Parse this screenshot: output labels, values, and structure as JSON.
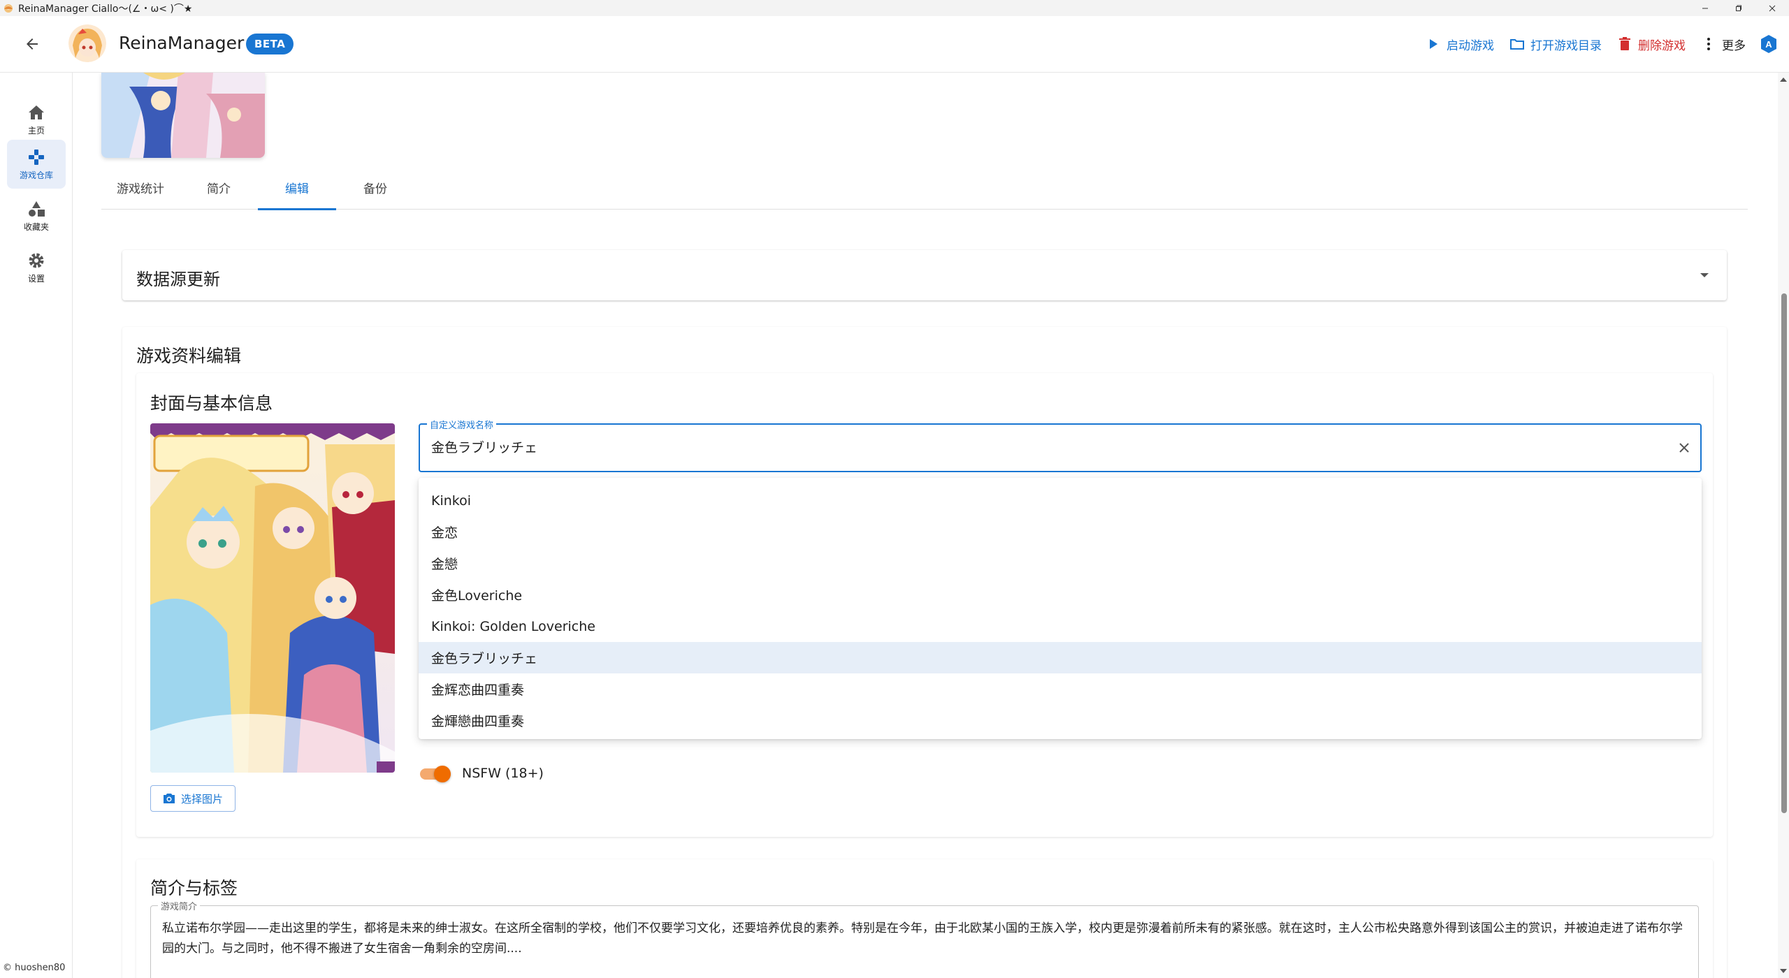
{
  "window": {
    "title": "ReinaManager Ciallo～(∠・ω< )⌒★",
    "controls": [
      "minimize",
      "restore",
      "close"
    ]
  },
  "appbar": {
    "title": "ReinaManager",
    "badge": "BETA",
    "actions": {
      "launch": "启动游戏",
      "open_dir": "打开游戏目录",
      "delete": "删除游戏",
      "more": "更多"
    },
    "colors": {
      "primary": "#1976d2",
      "danger": "#d32f2f"
    }
  },
  "sidenav": {
    "items": [
      {
        "label": "主页",
        "icon": "home-icon"
      },
      {
        "label": "游戏仓库",
        "icon": "gamepad-icon",
        "active": true
      },
      {
        "label": "收藏夹",
        "icon": "category-icon"
      },
      {
        "label": "设置",
        "icon": "gear-icon"
      }
    ],
    "copyright": "© huoshen80"
  },
  "tabs": [
    {
      "label": "游戏统计"
    },
    {
      "label": "简介"
    },
    {
      "label": "编辑",
      "active": true
    },
    {
      "label": "备份"
    }
  ],
  "datasource": {
    "title": "数据源更新"
  },
  "edit": {
    "title": "游戏资料编辑",
    "cover_section": {
      "title": "封面与基本信息",
      "pick_image": "选择图片",
      "name_field": {
        "label": "自定义游戏名称",
        "value": "金色ラブリッチェ"
      },
      "options": [
        "Kinkoi",
        "金恋",
        "金戀",
        "金色Loveriche",
        "Kinkoi: Golden Loveriche",
        "金色ラブリッチェ",
        "金辉恋曲四重奏",
        "金輝戀曲四重奏"
      ],
      "selected_option_index": 5,
      "nsfw": {
        "label": "NSFW (18+)",
        "enabled": true,
        "color": "#ef6c00"
      }
    },
    "desc_section": {
      "title": "简介与标签",
      "field_label": "游戏简介",
      "text": "私立诺布尔学园——走出这里的学生，都将是未来的绅士淑女。在这所全宿制的学校，他们不仅要学习文化，还要培养优良的素养。特别是在今年，由于北欧某小国的王族入学，校内更是弥漫着前所未有的紧张感。就在这时，主人公市松央路意外得到该国公主的赏识，并被迫走进了诺布尔学园的大门。与之同时，他不得不搬进了女生宿舍一角剩余的空房间...."
    }
  }
}
